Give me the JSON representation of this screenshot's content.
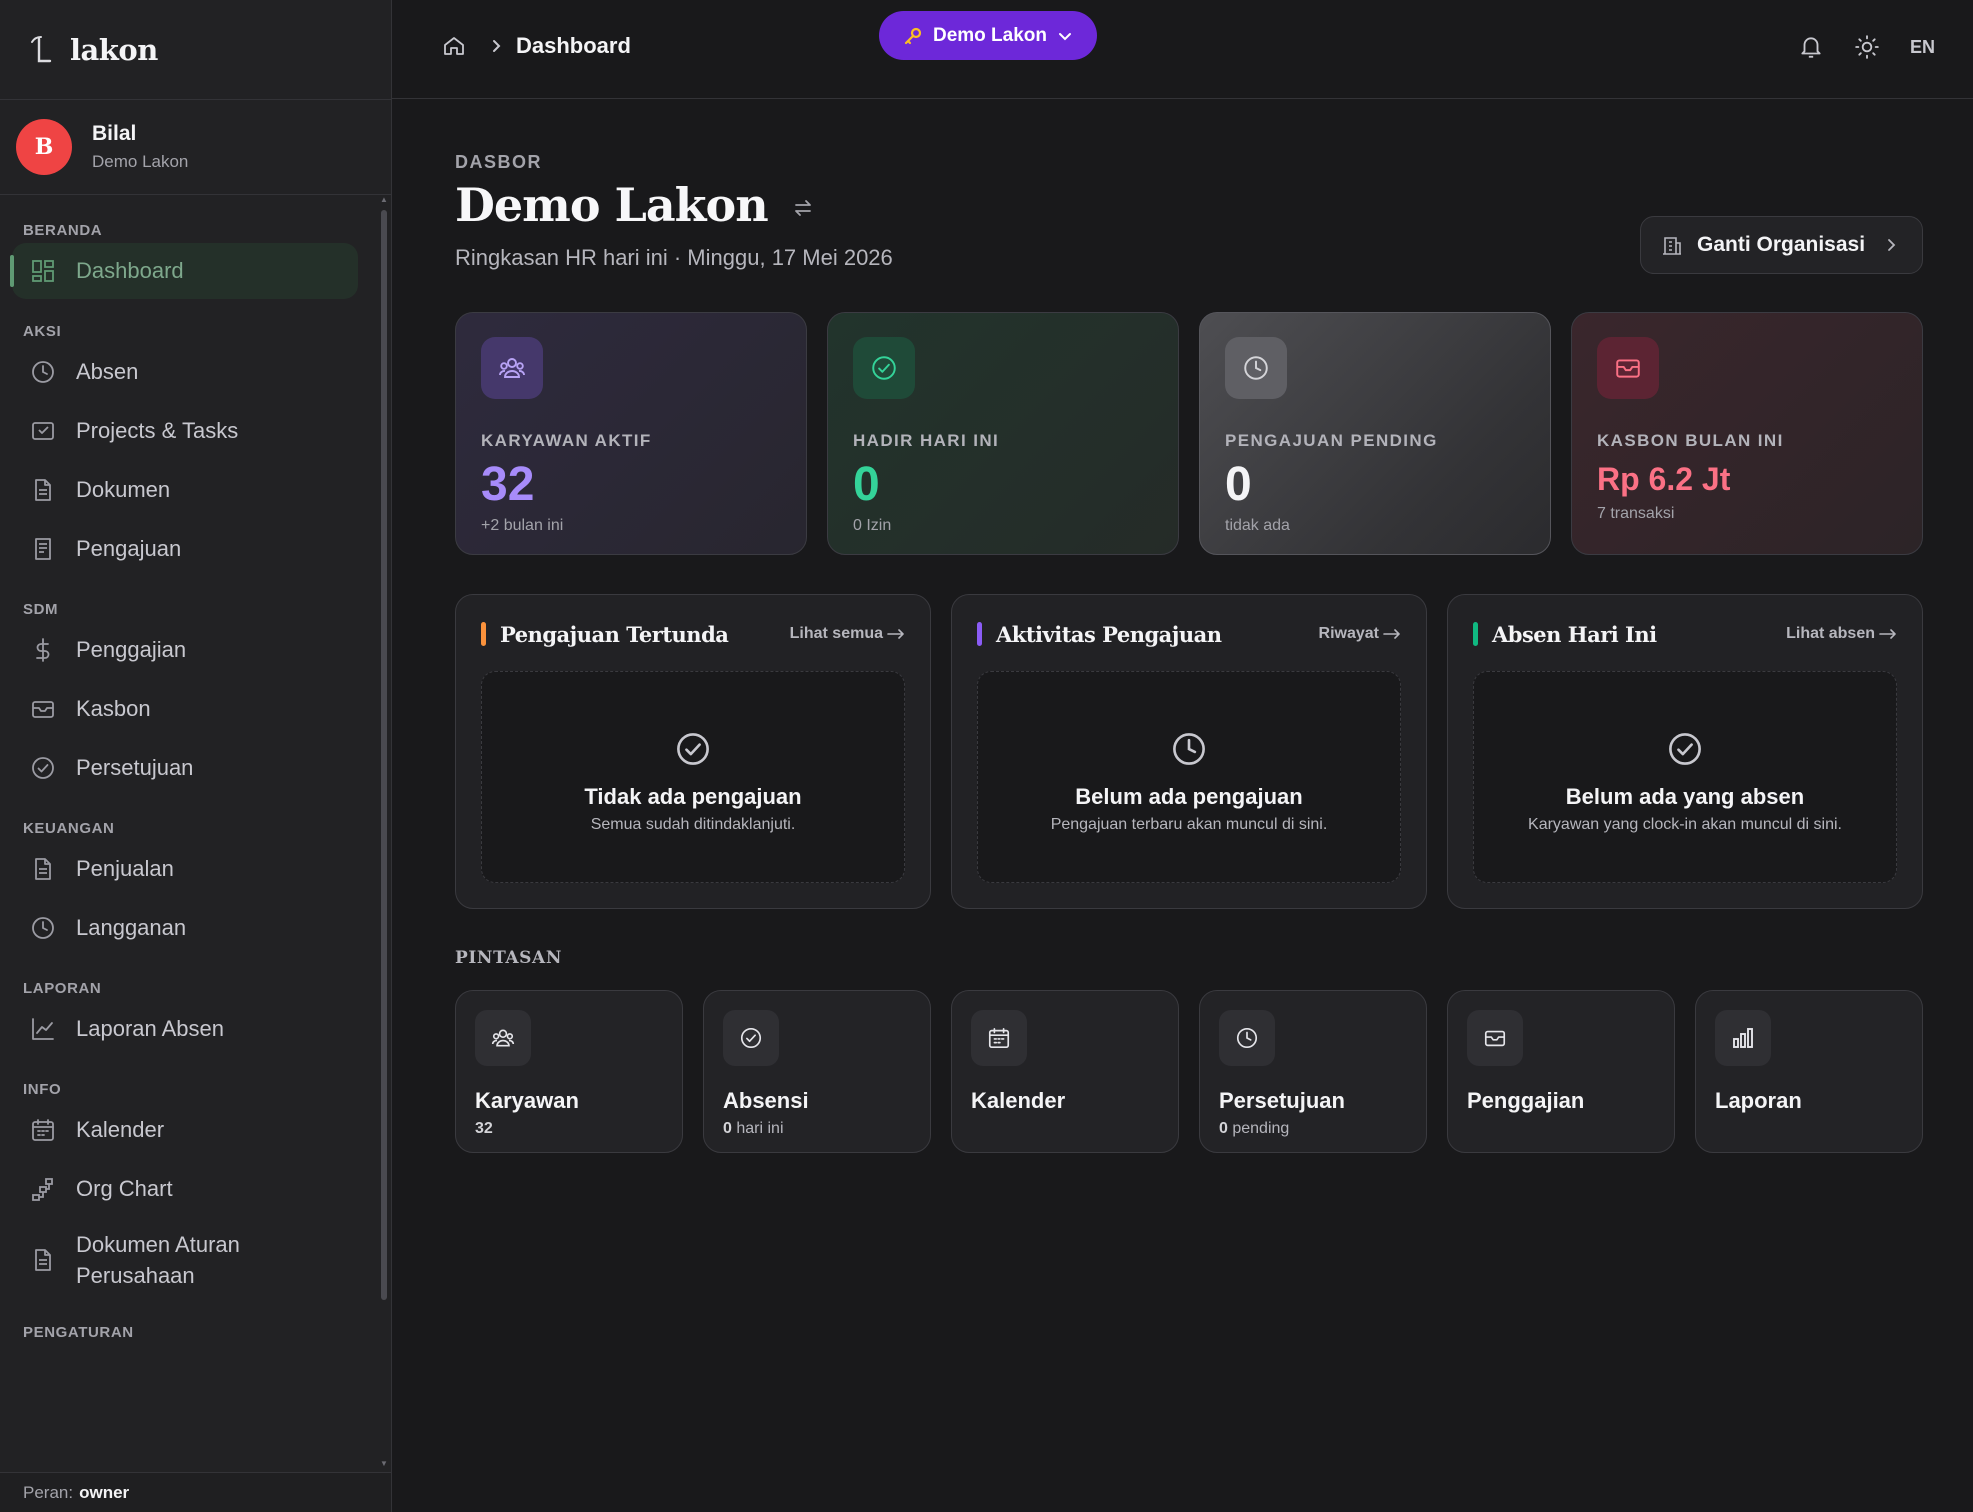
{
  "brand": {
    "name": "lakon"
  },
  "user": {
    "initial": "B",
    "name": "Bilal",
    "org": "Demo Lakon"
  },
  "nav": {
    "sections": [
      {
        "title": "BERANDA",
        "items": [
          {
            "label": "Dashboard",
            "icon": "dashboard-icon",
            "active": true
          }
        ]
      },
      {
        "title": "AKSI",
        "items": [
          {
            "label": "Absen",
            "icon": "clock-icon"
          },
          {
            "label": "Projects & Tasks",
            "icon": "inbox-check-icon"
          },
          {
            "label": "Dokumen",
            "icon": "document-icon"
          },
          {
            "label": "Pengajuan",
            "icon": "receipt-icon"
          }
        ]
      },
      {
        "title": "SDM",
        "items": [
          {
            "label": "Penggajian",
            "icon": "dollar-icon"
          },
          {
            "label": "Kasbon",
            "icon": "wallet-icon"
          },
          {
            "label": "Persetujuan",
            "icon": "check-circle-icon"
          }
        ]
      },
      {
        "title": "KEUANGAN",
        "items": [
          {
            "label": "Penjualan",
            "icon": "document-icon"
          },
          {
            "label": "Langganan",
            "icon": "clock-icon"
          }
        ]
      },
      {
        "title": "LAPORAN",
        "items": [
          {
            "label": "Laporan Absen",
            "icon": "line-chart-icon"
          }
        ]
      },
      {
        "title": "INFO",
        "items": [
          {
            "label": "Kalender",
            "icon": "calendar-icon"
          },
          {
            "label": "Org Chart",
            "icon": "org-chart-icon"
          },
          {
            "label": "Dokumen Aturan Perusahaan",
            "icon": "document-icon"
          }
        ]
      },
      {
        "title": "PENGATURAN",
        "items": []
      }
    ]
  },
  "role": {
    "label": "Peran:",
    "value": "owner"
  },
  "topbar": {
    "breadcrumb_current": "Dashboard",
    "org_pill": "Demo Lakon",
    "lang": "EN"
  },
  "header": {
    "kicker": "DASBOR",
    "title": "Demo Lakon",
    "subtitle": "Ringkasan HR hari ini · Minggu, 17 Mei 2026",
    "switch_label": "Ganti Organisasi"
  },
  "stats": [
    {
      "label": "KARYAWAN AKTIF",
      "value": "32",
      "note": "+2 bulan ini",
      "theme": "purple",
      "icon": "users-icon"
    },
    {
      "label": "HADIR HARI INI",
      "value": "0",
      "note": "0 Izin",
      "theme": "green",
      "icon": "check-circle-icon"
    },
    {
      "label": "PENGAJUAN PENDING",
      "value": "0",
      "note": "tidak ada",
      "theme": "gray",
      "icon": "clock-icon"
    },
    {
      "label": "KASBON BULAN INI",
      "value": "Rp 6.2 Jt",
      "note": "7 transaksi",
      "theme": "red",
      "icon": "wallet-icon"
    }
  ],
  "panels": [
    {
      "title": "Pengajuan Tertunda",
      "link": "Lihat semua",
      "accent": "#fb923c",
      "empty_title": "Tidak ada pengajuan",
      "empty_sub": "Semua sudah ditindaklanjuti.",
      "icon": "check-circle-icon"
    },
    {
      "title": "Aktivitas Pengajuan",
      "link": "Riwayat",
      "accent": "#8b5cf6",
      "empty_title": "Belum ada pengajuan",
      "empty_sub": "Pengajuan terbaru akan muncul di sini.",
      "icon": "clock-icon"
    },
    {
      "title": "Absen Hari Ini",
      "link": "Lihat absen",
      "accent": "#10b981",
      "empty_title": "Belum ada yang absen",
      "empty_sub": "Karyawan yang clock-in akan muncul di sini.",
      "icon": "check-circle-icon"
    }
  ],
  "shortcuts": {
    "label": "PINTASAN",
    "items": [
      {
        "title": "Karyawan",
        "count": "32",
        "sub": "",
        "icon": "users-icon"
      },
      {
        "title": "Absensi",
        "count": "0",
        "sub": "hari ini",
        "icon": "check-circle-icon"
      },
      {
        "title": "Kalender",
        "count": "",
        "sub": "",
        "icon": "calendar-icon"
      },
      {
        "title": "Persetujuan",
        "count": "0",
        "sub": "pending",
        "icon": "clock-icon"
      },
      {
        "title": "Penggajian",
        "count": "",
        "sub": "",
        "icon": "wallet-icon"
      },
      {
        "title": "Laporan",
        "count": "",
        "sub": "",
        "icon": "bar-chart-icon"
      }
    ]
  },
  "colors": {
    "accent_purple": "#6d28d9",
    "active_green": "#5f9a73",
    "avatar_red": "#ef4444"
  }
}
